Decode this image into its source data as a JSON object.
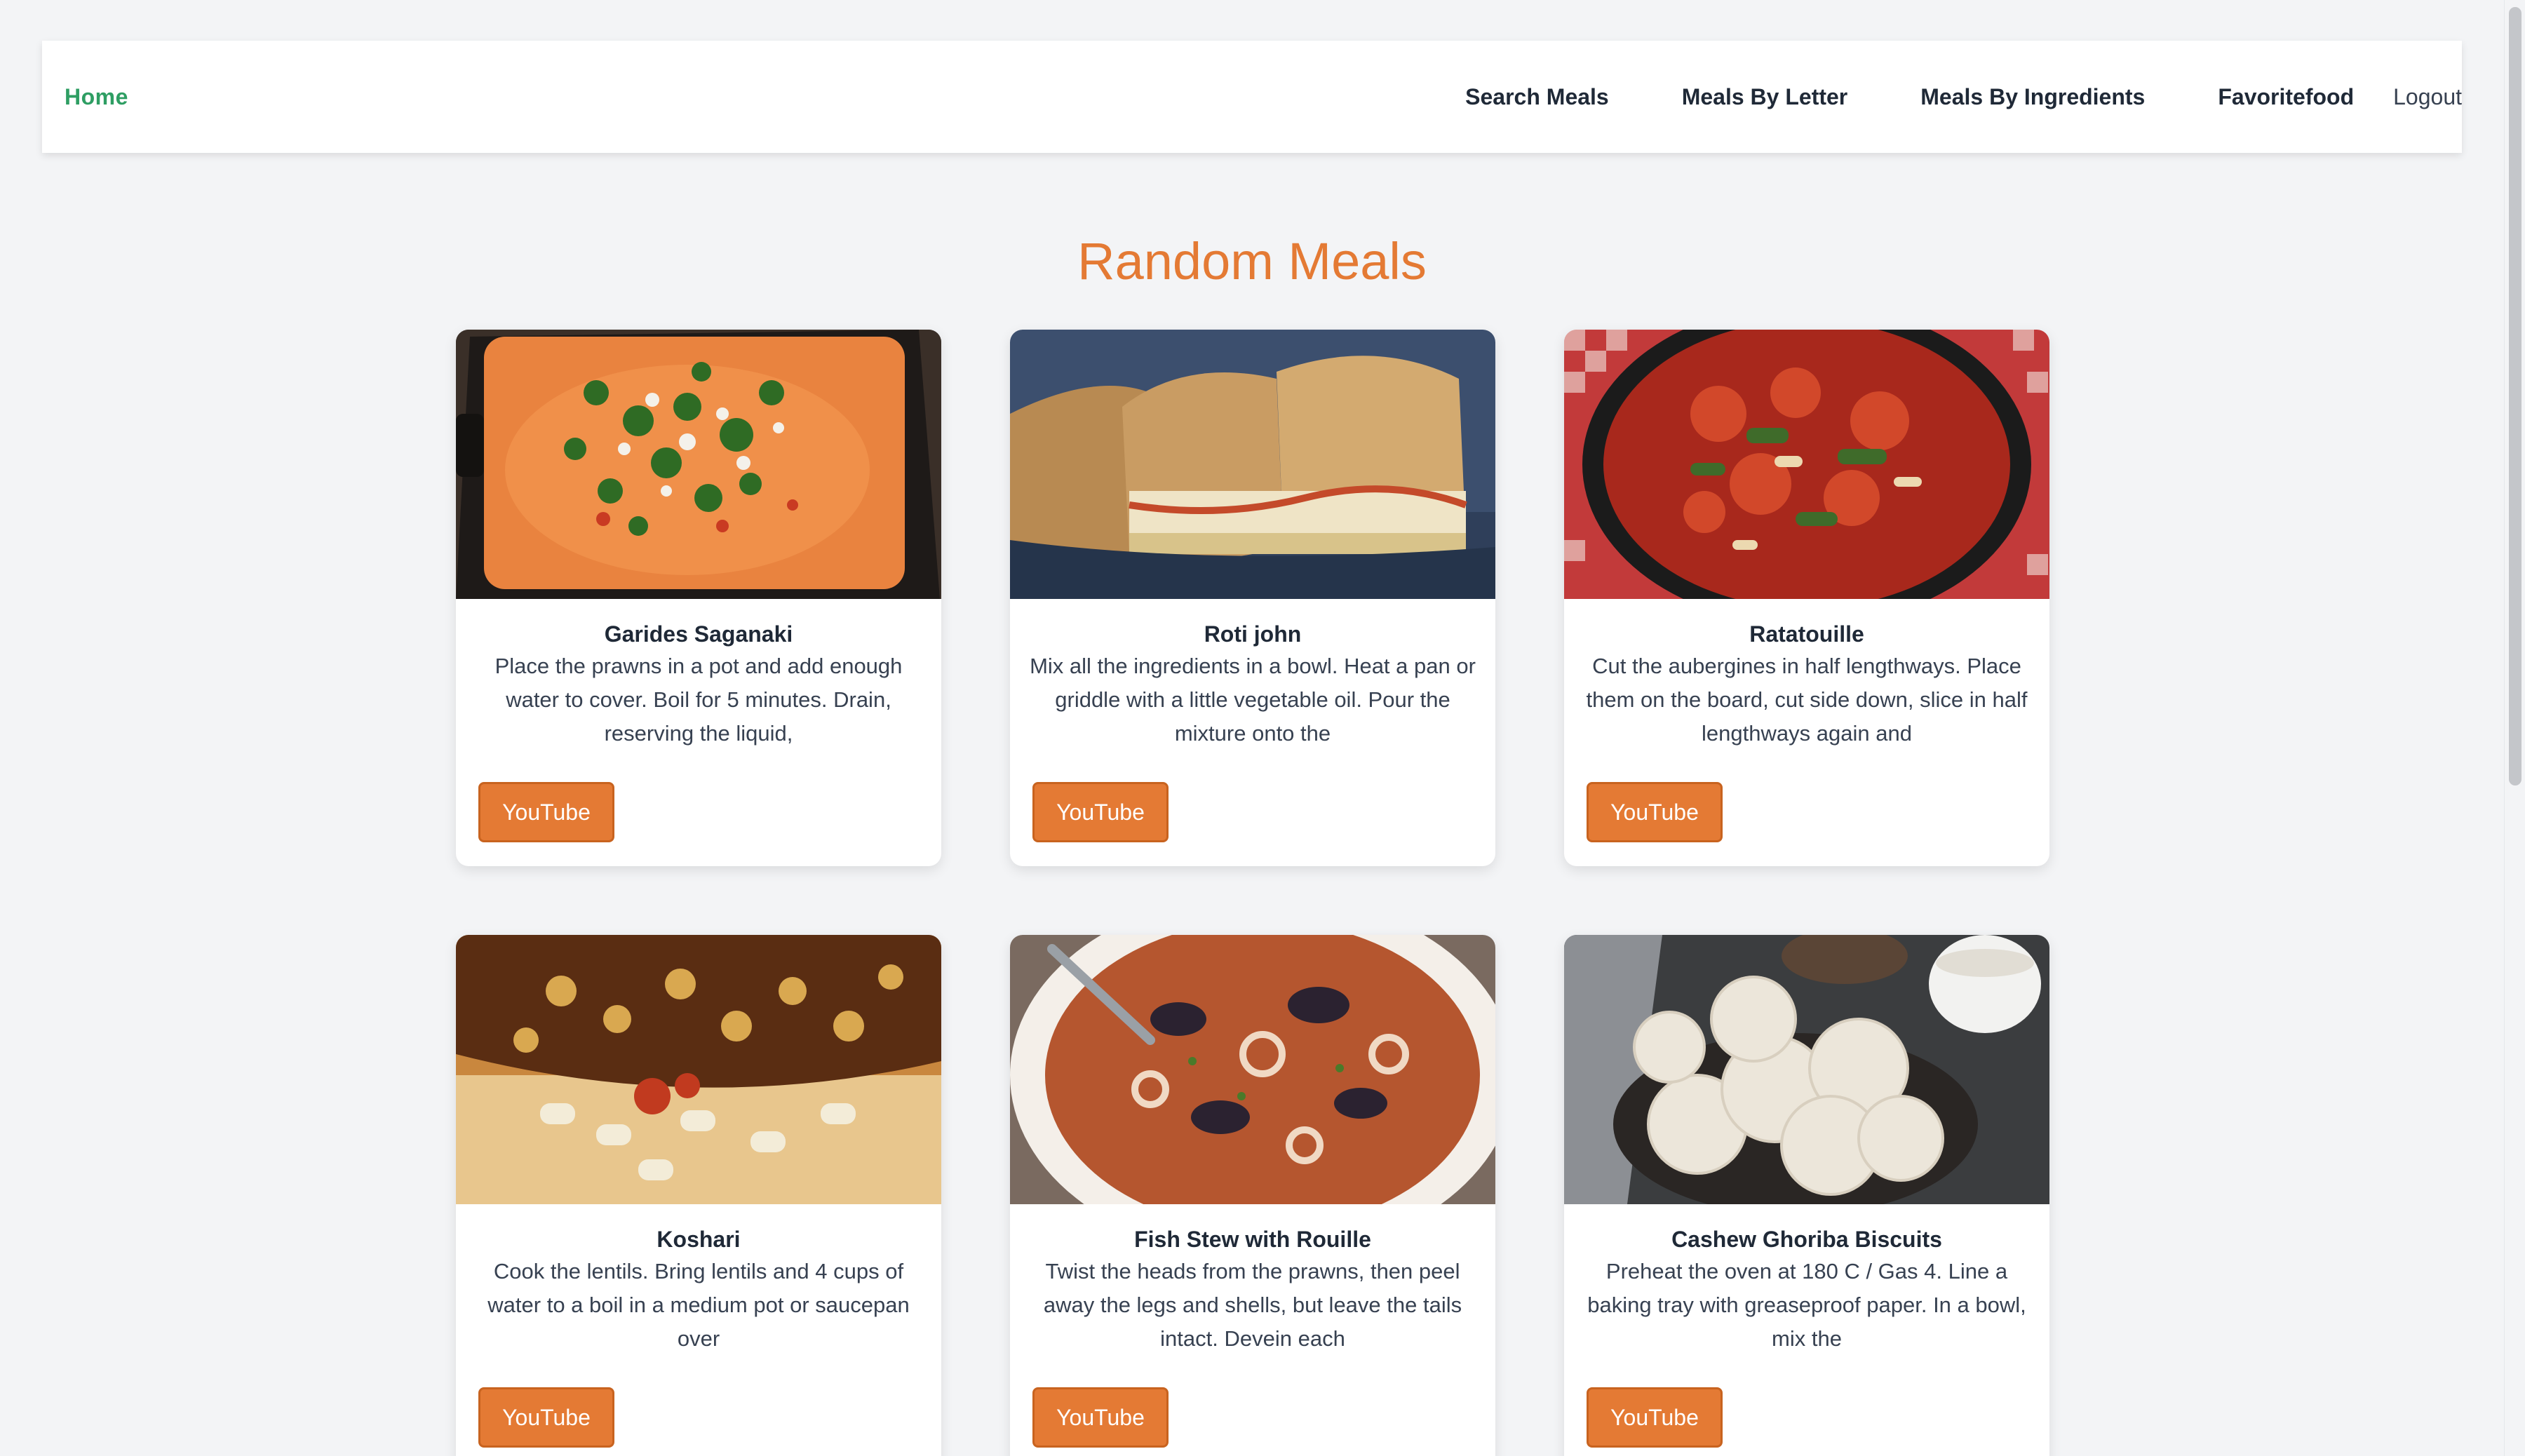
{
  "nav": {
    "home": "Home",
    "links": [
      "Search Meals",
      "Meals By Letter",
      "Meals By Ingredients",
      "Favoritefood"
    ],
    "logout": "Logout"
  },
  "main": {
    "title": "Random Meals"
  },
  "meals": [
    {
      "name": "Garides Saganaki",
      "description": "Place the prawns in a pot and add enough water to cover. Boil for 5 minutes. Drain, reserving the liquid,",
      "button": "YouTube",
      "image": "prawn-saganaki-photo"
    },
    {
      "name": "Roti john",
      "description": "Mix all the ingredients in a bowl. Heat a pan or griddle with a little vegetable oil. Pour the mixture onto the",
      "button": "YouTube",
      "image": "roti-john-sandwich-photo"
    },
    {
      "name": "Ratatouille",
      "description": "Cut the aubergines in half lengthways. Place them on the board, cut side down, slice in half lengthways again and",
      "button": "YouTube",
      "image": "ratatouille-pan-photo"
    },
    {
      "name": "Koshari",
      "description": "Cook the lentils. Bring lentils and 4 cups of water to a boil in a medium pot or saucepan over",
      "button": "YouTube",
      "image": "koshari-plate-photo"
    },
    {
      "name": "Fish Stew with Rouille",
      "description": "Twist the heads from the prawns, then peel away the legs and shells, but leave the tails intact. Devein each",
      "button": "YouTube",
      "image": "fish-stew-bowl-photo"
    },
    {
      "name": "Cashew Ghoriba Biscuits",
      "description": "Preheat the oven at 180 C / Gas 4. Line a baking tray with greaseproof paper. In a bowl, mix the",
      "button": "YouTube",
      "image": "ghoriba-biscuits-photo"
    }
  ],
  "colors": {
    "accent": "#e47a34",
    "home_link": "#2e9e63",
    "background": "#f3f4f6"
  }
}
